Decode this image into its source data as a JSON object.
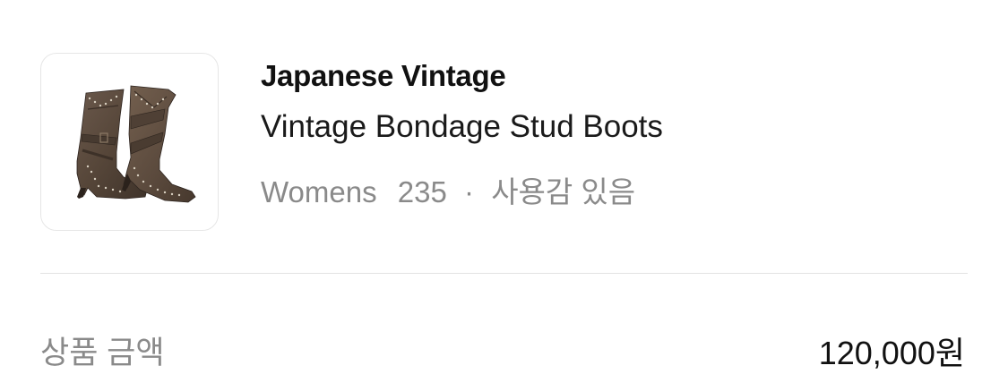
{
  "product": {
    "brand": "Japanese Vintage",
    "name": "Vintage Bondage Stud Boots",
    "category": "Womens",
    "size": "235",
    "separator": "·",
    "condition": "사용감 있음",
    "image_icon": "boots-photo"
  },
  "price": {
    "label": "상품 금액",
    "value": "120,000원"
  },
  "colors": {
    "brand_text": "#111111",
    "meta_text": "#8a8a8a",
    "divider": "#e3e3e3",
    "boot_suede": "#5a4a3f"
  }
}
